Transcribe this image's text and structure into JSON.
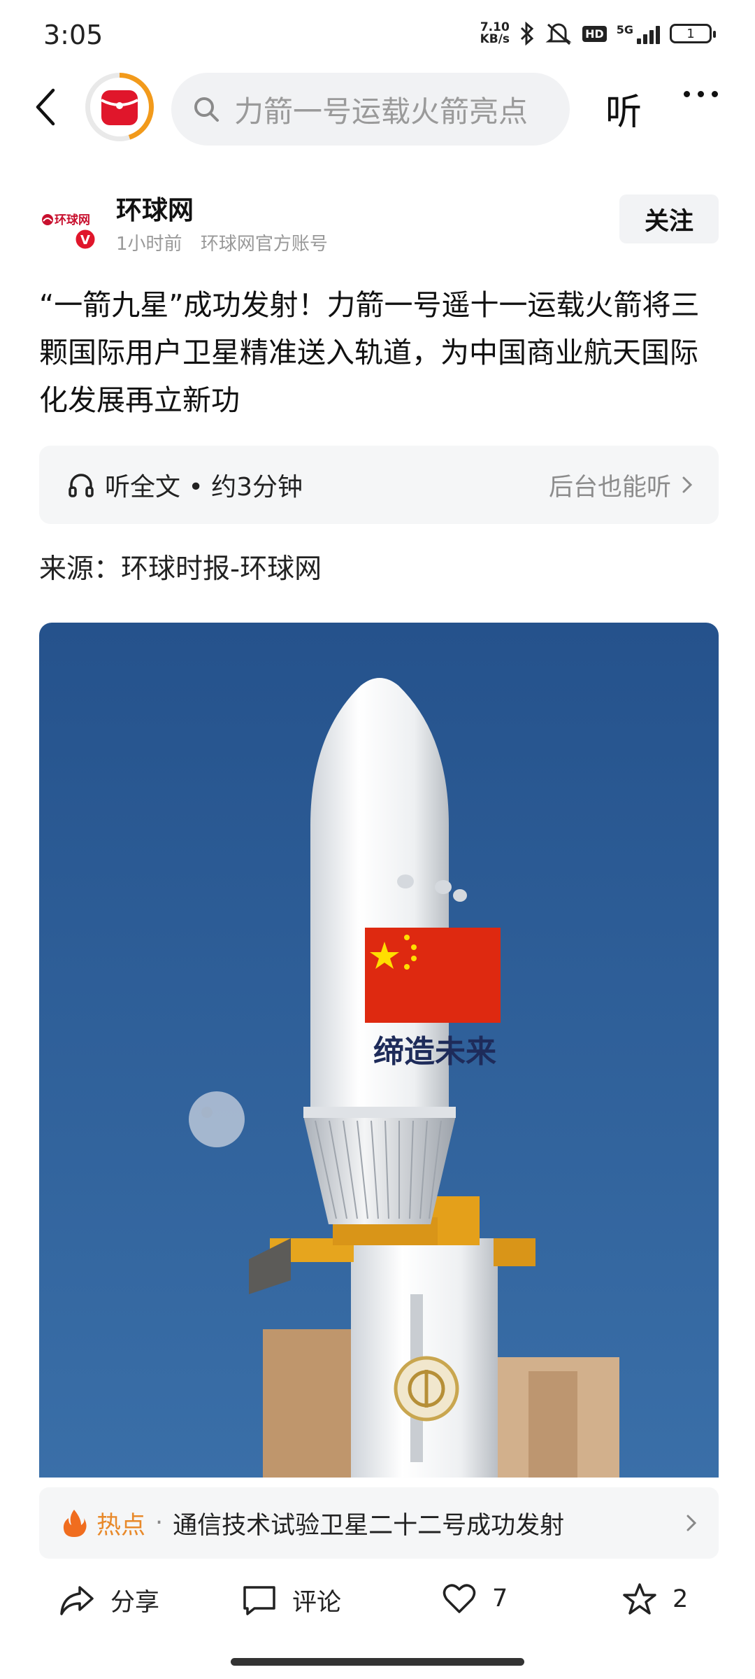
{
  "status_bar": {
    "time": "3:05",
    "net_speed_value": "7.10",
    "net_speed_unit": "KB/s",
    "hd_badge": "HD",
    "network": "5G",
    "battery": "1"
  },
  "topbar": {
    "search_placeholder": "力箭一号运载火箭亮点",
    "listen_label": "听",
    "search_icon": "search-icon",
    "back_icon": "back-icon",
    "more_icon": "more-icon"
  },
  "author": {
    "name": "环球网",
    "time": "1小时前",
    "account": "环球网官方账号",
    "follow_label": "关注",
    "logo_text": "环球网",
    "verified_mark": "V"
  },
  "article": {
    "headline": "“一箭九星”成功发射！力箭一号遥十一运载火箭将三颗国际用户卫星精准送入轨道，为中国商业航天国际化发展再立新功",
    "source": "来源：环球时报-环球网",
    "image_caption_text": "缔造未来"
  },
  "listen_bar": {
    "full_text": "听全文 • 约3分钟",
    "background_text": "后台也能听"
  },
  "hot": {
    "label": "热点",
    "separator": "·",
    "title": "通信技术试验卫星二十二号成功发射"
  },
  "actions": {
    "share": "分享",
    "comment": "评论",
    "like_count": "7",
    "favorite_count": "2"
  },
  "colors": {
    "accent_orange": "#f29a1b",
    "brand_red": "#e0162b",
    "sky_blue": "#2f5d95"
  }
}
